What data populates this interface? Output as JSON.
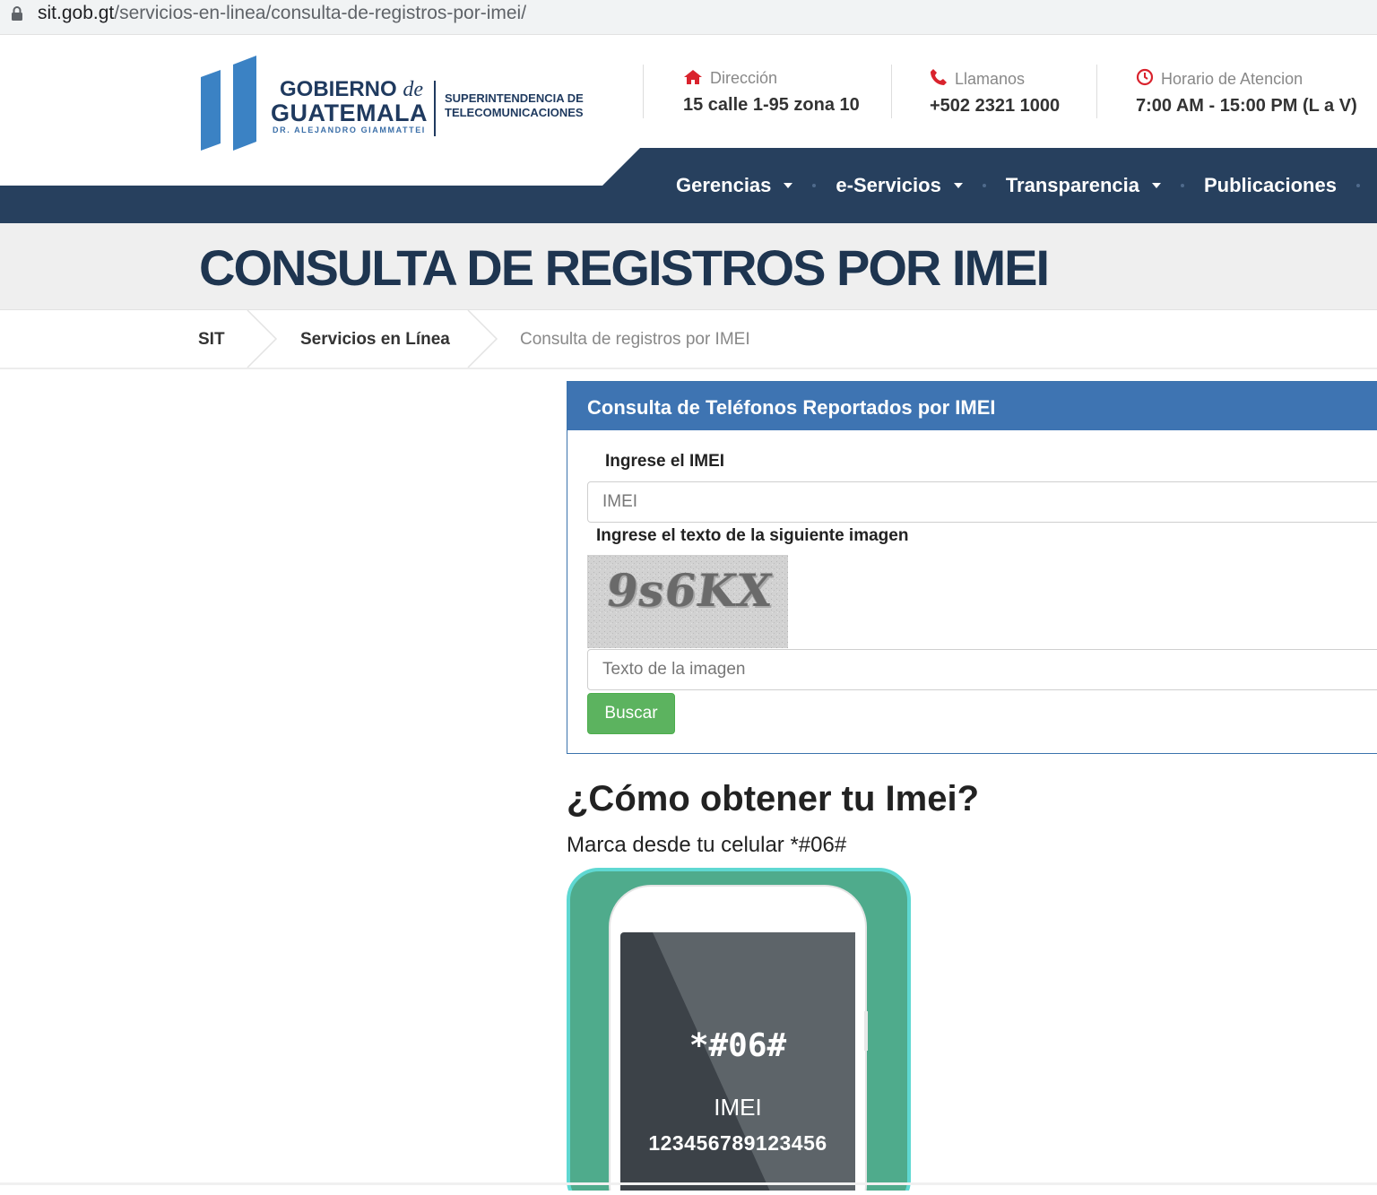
{
  "browser": {
    "url_host": "sit.gob.gt",
    "url_path": "/servicios-en-linea/consulta-de-registros-por-imei/"
  },
  "logo": {
    "line1": "GOBIERNO",
    "line1_de": "de",
    "line2": "GUATEMALA",
    "line3": "DR. ALEJANDRO GIAMMATTEI",
    "agency_line1": "SUPERINTENDENCIA DE",
    "agency_line2": "TELECOMUNICACIONES"
  },
  "header": {
    "direccion_label": "Dirección",
    "direccion_value": "15 calle 1-95 zona 10",
    "llamanos_label": "Llamanos",
    "llamanos_value": "+502 2321 1000",
    "horario_label": "Horario de Atencion",
    "horario_value": "7:00 AM - 15:00 PM (L a V)",
    "icon_color": "#d9232d"
  },
  "nav": {
    "items": [
      "Gerencias",
      "e-Servicios",
      "Transparencia",
      "Publicaciones"
    ]
  },
  "page": {
    "title": "CONSULTA DE REGISTROS POR IMEI"
  },
  "breadcrumb": {
    "items": [
      "SIT",
      "Servicios en Línea",
      "Consulta de registros por IMEI"
    ]
  },
  "form": {
    "panel_title": "Consulta de Teléfonos Reportados por IMEI",
    "imei_label": "Ingrese el IMEI",
    "imei_placeholder": "IMEI",
    "captcha_label": "Ingrese el texto de la siguiente imagen",
    "captcha_text": "9s6KX",
    "captcha_placeholder": "Texto de la imagen",
    "submit_label": "Buscar",
    "submit_color": "#5cb35f"
  },
  "howto": {
    "title": "¿Cómo obtener tu Imei?",
    "subtitle": "Marca desde tu celular *#06#",
    "screen_code": "*#06#",
    "screen_label": "IMEI",
    "screen_number": "123456789123456"
  }
}
